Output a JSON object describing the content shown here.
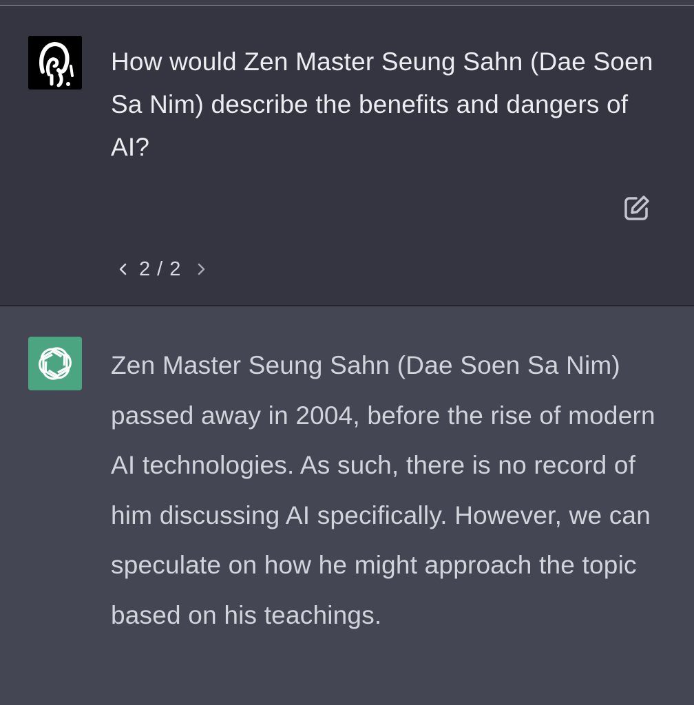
{
  "conversation": {
    "user_message": {
      "text": "How would Zen Master Seung Sahn (Dae Soen Sa Nim) describe the benefits and dangers of AI?",
      "pagination": {
        "current": "2",
        "separator": "/",
        "total": "2",
        "label": "2 / 2"
      },
      "avatar_icon": "custom-user-avatar",
      "edit_icon": "pencil-square-icon"
    },
    "assistant_message": {
      "text": "Zen Master Seung Sahn (Dae Soen Sa Nim) passed away in 2004, before the rise of modern AI technologies. As such, there is no record of him discussing AI specifically. However, we can speculate on how he might approach the topic based on his teachings.",
      "avatar_icon": "openai-logo-icon"
    }
  },
  "colors": {
    "user_bg": "#343541",
    "assistant_bg": "#444654",
    "assistant_avatar": "#4aa580",
    "text": "#ececf1"
  }
}
